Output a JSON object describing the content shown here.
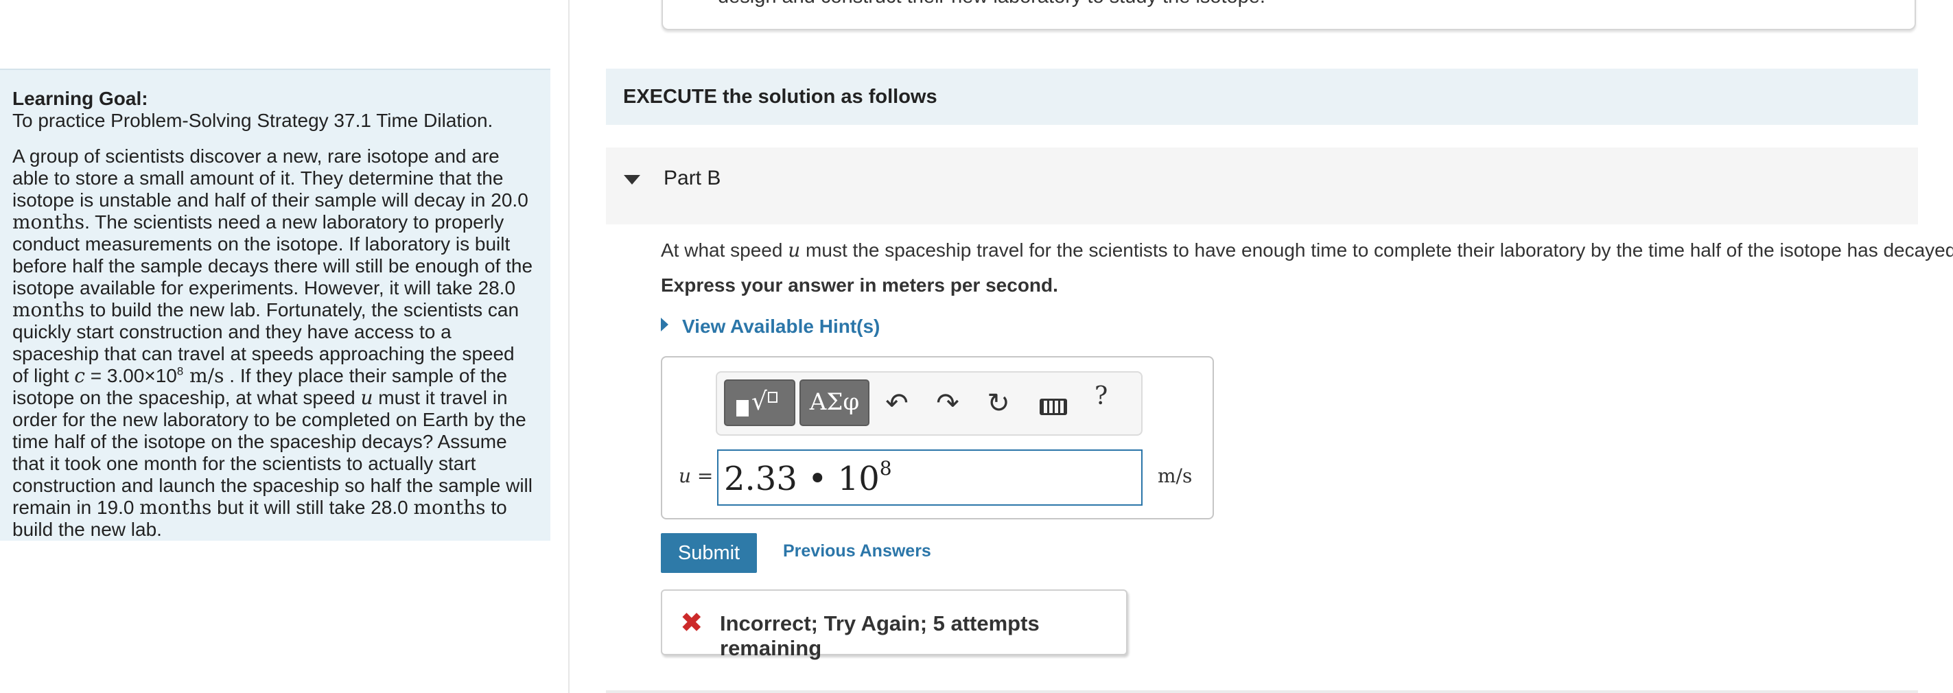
{
  "top_card": {
    "text": "design and construct their new laboratory to study the isotope."
  },
  "learning_goal": {
    "title": "Learning Goal:",
    "subtitle": "To practice Problem-Solving Strategy 37.1 Time Dilation.",
    "p1": "A group of scientists discover a new, rare isotope and are able to store a small amount of it. They determine that the isotope is unstable and half of their sample will decay in 20.0 ",
    "months": "months",
    "p2": ". The scientists need a new laboratory to properly conduct measurements on the isotope. If laboratory is built before half the sample decays there will still be enough of the isotope available for experiments. However, it will take 28.0 ",
    "p3": " to build the new lab. Fortunately, the scientists can quickly start construction and they have access to a spaceship that can travel at speeds approaching the speed of light ",
    "c_var": "c",
    "c_val": " = 3.00×10",
    "c_exp": "8",
    "speed_unit": " m/s",
    "p4": " . If they place their sample of the isotope on the spaceship, at what speed ",
    "u_var": "u",
    "p5": " must it travel in order for the new laboratory to be completed on Earth by the time half of the isotope on the spaceship decays? Assume that it took one month for the scientists to actually start construction and launch the spaceship so half the sample will remain in 19.0 ",
    "p6": " but it will still take 28.0 ",
    "p7": " to build the new lab."
  },
  "execute": {
    "label": "EXECUTE the solution as follows"
  },
  "part_b": {
    "label": "Part B",
    "question_pre": "At what speed ",
    "question_var": "u",
    "question_post": " must the spaceship travel for the scientists to have enough time to complete their laboratory by the time half of the isotope has decayed?",
    "express": "Express your answer in meters per second.",
    "hints": "View Available Hint(s)"
  },
  "answer": {
    "var_label": "u =",
    "value": "2.33 • 10",
    "exponent": "8",
    "unit": "m/s"
  },
  "toolbar": {
    "greek": "ΑΣφ",
    "undo": "↶",
    "redo": "↷",
    "reset": "↻",
    "help": "?"
  },
  "actions": {
    "submit": "Submit",
    "previous": "Previous Answers"
  },
  "feedback": {
    "icon": "✖",
    "text": "Incorrect; Try Again; 5 attempts remaining"
  }
}
